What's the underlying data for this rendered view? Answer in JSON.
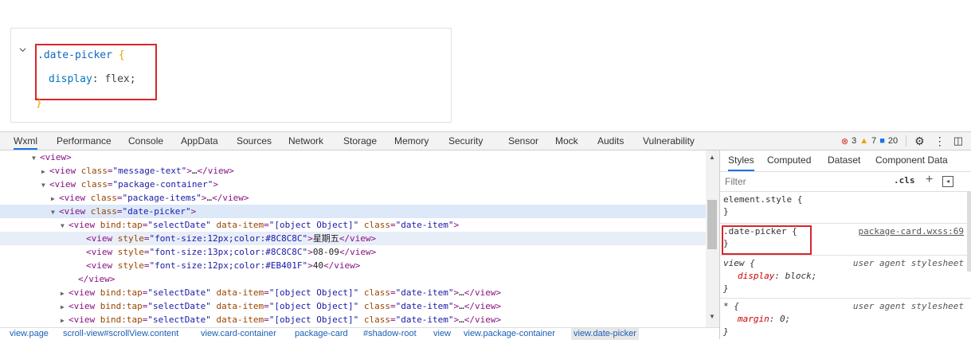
{
  "snippet": {
    "selector": ".date-picker",
    "open_brace": "{",
    "property": "display",
    "colon": ":",
    "value": "flex",
    "semicolon": ";",
    "close_brace": "}"
  },
  "tabs": [
    "Wxml",
    "Performance",
    "Console",
    "AppData",
    "Sources",
    "Network",
    "Storage",
    "Memory",
    "Security",
    "Sensor",
    "Mock",
    "Audits",
    "Vulnerability"
  ],
  "status": {
    "errors": "3",
    "warnings": "7",
    "infos": "20"
  },
  "tree": [
    {
      "tri": "▼",
      "parts": [
        [
          "tag",
          "<view>"
        ]
      ]
    },
    {
      "tri": "▶",
      "parts": [
        [
          "tag",
          "<view "
        ],
        [
          "attr",
          "class"
        ],
        [
          "tag",
          "="
        ],
        [
          "aval",
          "\"message-text\""
        ],
        [
          "tag",
          ">"
        ],
        [
          "txt",
          "…"
        ],
        [
          "tag",
          "</view>"
        ]
      ]
    },
    {
      "tri": "▼",
      "parts": [
        [
          "tag",
          "<view "
        ],
        [
          "attr",
          "class"
        ],
        [
          "tag",
          "="
        ],
        [
          "aval",
          "\"package-container\""
        ],
        [
          "tag",
          ">"
        ]
      ]
    },
    {
      "tri": "▶",
      "parts": [
        [
          "tag",
          "<view "
        ],
        [
          "attr",
          "class"
        ],
        [
          "tag",
          "="
        ],
        [
          "aval",
          "\"package-items\""
        ],
        [
          "tag",
          ">"
        ],
        [
          "txt",
          "…"
        ],
        [
          "tag",
          "</view>"
        ]
      ]
    },
    {
      "tri": "▼",
      "parts": [
        [
          "tag",
          "<view "
        ],
        [
          "attr",
          "class"
        ],
        [
          "tag",
          "="
        ],
        [
          "aval",
          "\"date-picker\""
        ],
        [
          "tag",
          ">"
        ]
      ]
    },
    {
      "tri": "▼",
      "parts": [
        [
          "tag",
          "<view "
        ],
        [
          "attr",
          "bind:tap"
        ],
        [
          "tag",
          "="
        ],
        [
          "aval",
          "\"selectDate\""
        ],
        [
          "tag",
          " "
        ],
        [
          "attr",
          "data-item"
        ],
        [
          "tag",
          "="
        ],
        [
          "aval",
          "\"[object Object]\""
        ],
        [
          "tag",
          " "
        ],
        [
          "attr",
          "class"
        ],
        [
          "tag",
          "="
        ],
        [
          "aval",
          "\"date-item\""
        ],
        [
          "tag",
          ">"
        ]
      ]
    },
    {
      "tri": "",
      "parts": [
        [
          "tag",
          "<view "
        ],
        [
          "attr",
          "style"
        ],
        [
          "tag",
          "="
        ],
        [
          "aval",
          "\"font-size:12px;color:#8C8C8C\""
        ],
        [
          "tag",
          ">"
        ],
        [
          "txt",
          "星期五"
        ],
        [
          "tag",
          "</view>"
        ]
      ]
    },
    {
      "tri": "",
      "parts": [
        [
          "tag",
          "<view "
        ],
        [
          "attr",
          "style"
        ],
        [
          "tag",
          "="
        ],
        [
          "aval",
          "\"font-size:13px;color:#8C8C8C\""
        ],
        [
          "tag",
          ">"
        ],
        [
          "txt",
          "08-09"
        ],
        [
          "tag",
          "</view>"
        ]
      ]
    },
    {
      "tri": "",
      "parts": [
        [
          "tag",
          "<view "
        ],
        [
          "attr",
          "style"
        ],
        [
          "tag",
          "="
        ],
        [
          "aval",
          "\"font-size:12px;color:#EB401F\""
        ],
        [
          "tag",
          ">"
        ],
        [
          "txt",
          "40"
        ],
        [
          "tag",
          "</view>"
        ]
      ]
    },
    {
      "tri": "",
      "parts": [
        [
          "tag",
          "</view>"
        ]
      ]
    },
    {
      "tri": "▶",
      "parts": [
        [
          "tag",
          "<view "
        ],
        [
          "attr",
          "bind:tap"
        ],
        [
          "tag",
          "="
        ],
        [
          "aval",
          "\"selectDate\""
        ],
        [
          "tag",
          " "
        ],
        [
          "attr",
          "data-item"
        ],
        [
          "tag",
          "="
        ],
        [
          "aval",
          "\"[object Object]\""
        ],
        [
          "tag",
          " "
        ],
        [
          "attr",
          "class"
        ],
        [
          "tag",
          "="
        ],
        [
          "aval",
          "\"date-item\""
        ],
        [
          "tag",
          ">"
        ],
        [
          "txt",
          "…"
        ],
        [
          "tag",
          "</view>"
        ]
      ]
    },
    {
      "tri": "▶",
      "parts": [
        [
          "tag",
          "<view "
        ],
        [
          "attr",
          "bind:tap"
        ],
        [
          "tag",
          "="
        ],
        [
          "aval",
          "\"selectDate\""
        ],
        [
          "tag",
          " "
        ],
        [
          "attr",
          "data-item"
        ],
        [
          "tag",
          "="
        ],
        [
          "aval",
          "\"[object Object]\""
        ],
        [
          "tag",
          " "
        ],
        [
          "attr",
          "class"
        ],
        [
          "tag",
          "="
        ],
        [
          "aval",
          "\"date-item\""
        ],
        [
          "tag",
          ">"
        ],
        [
          "txt",
          "…"
        ],
        [
          "tag",
          "</view>"
        ]
      ]
    },
    {
      "tri": "▶",
      "parts": [
        [
          "tag",
          "<view "
        ],
        [
          "attr",
          "bind:tap"
        ],
        [
          "tag",
          "="
        ],
        [
          "aval",
          "\"selectDate\""
        ],
        [
          "tag",
          " "
        ],
        [
          "attr",
          "data-item"
        ],
        [
          "tag",
          "="
        ],
        [
          "aval",
          "\"[object Object]\""
        ],
        [
          "tag",
          " "
        ],
        [
          "attr",
          "class"
        ],
        [
          "tag",
          "="
        ],
        [
          "aval",
          "\"date-item\""
        ],
        [
          "tag",
          ">"
        ],
        [
          "txt",
          "…"
        ],
        [
          "tag",
          "</view>"
        ]
      ]
    }
  ],
  "breadcrumb": [
    "view.page",
    "scroll-view#scrollView.content",
    "view.card-container",
    "package-card",
    "#shadow-root",
    "view",
    "view.package-container",
    "view.date-picker"
  ],
  "styles_pane": {
    "tabs": [
      "Styles",
      "Computed",
      "Dataset",
      "Component Data"
    ],
    "filter_placeholder": "Filter",
    "cls_label": ".cls",
    "plus_label": "+",
    "toggle_label": "◂",
    "rules": [
      {
        "selector": "element.style {",
        "source": "",
        "decl": "",
        "close": "}"
      },
      {
        "selector": ".date-picker {",
        "source": "package-card.wxss:69",
        "decl": "",
        "close": "}"
      },
      {
        "selector": "view {",
        "source": "user agent stylesheet",
        "decl_prop": "display",
        "decl_val": "block;",
        "close": "}"
      },
      {
        "selector": "* {",
        "source": "user agent stylesheet",
        "decl_prop": "margin",
        "decl_val": "0;",
        "close": "}"
      }
    ]
  }
}
